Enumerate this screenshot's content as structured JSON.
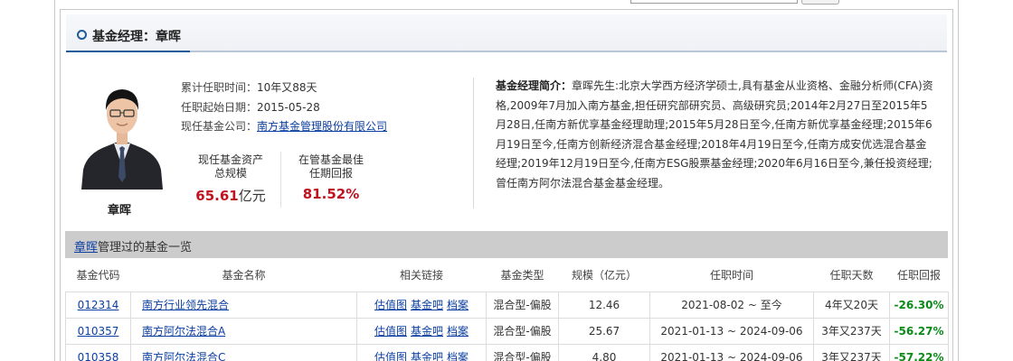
{
  "section": {
    "title": "基金经理：章晖"
  },
  "manager": {
    "name": "章晖",
    "tenure_label": "累计任职时间：",
    "tenure_value": "10年又88天",
    "start_label": "任职起始日期：",
    "start_value": "2015-05-28",
    "company_label": "现任基金公司：",
    "company_value": "南方基金管理股份有限公司"
  },
  "stats": {
    "aum_label_1": "现任基金资产",
    "aum_label_2": "总规模",
    "aum_value": "65.61",
    "aum_unit": "亿元",
    "best_label_1": "在管基金最佳",
    "best_label_2": "任期回报",
    "best_value": "81.52%"
  },
  "bio": {
    "label": "基金经理简介：",
    "text": "章晖先生:北京大学西方经济学硕士,具有基金从业资格、金融分析师(CFA)资格,2009年7月加入南方基金,担任研究部研究员、高级研究员;2014年2月27日至2015年5月28日,任南方新优享基金经理助理;2015年5月28日至今,任南方新优享基金经理;2015年6月19日至今,任南方创新经济混合基金经理;2018年4月19日至今,任南方成安优选混合基金经理;2019年12月19日至今,任南方ESG股票基金经理;2020年6月16日至今,兼任投资经理;曾任南方阿尔法混合基金基金经理。"
  },
  "funds": {
    "manager_link": "章晖",
    "title_suffix": "管理过的基金一览",
    "columns": [
      "基金代码",
      "基金名称",
      "相关链接",
      "基金类型",
      "规模（亿元）",
      "任职时间",
      "任职天数",
      "任职回报"
    ],
    "link_labels": [
      "估值图",
      "基金吧",
      "档案"
    ],
    "rows": [
      {
        "code": "012314",
        "name": "南方行业领先混合",
        "type": "混合型-偏股",
        "scale": "12.46",
        "period": "2021-08-02 ~ 至今",
        "days": "4年又20天",
        "return": "-26.30%"
      },
      {
        "code": "010357",
        "name": "南方阿尔法混合A",
        "type": "混合型-偏股",
        "scale": "25.67",
        "period": "2021-01-13 ~ 2024-09-06",
        "days": "3年又237天",
        "return": "-56.27%"
      },
      {
        "code": "010358",
        "name": "南方阿尔法混合C",
        "type": "混合型-偏股",
        "scale": "4.80",
        "period": "2021-01-13 ~ 2024-09-06",
        "days": "3年又237天",
        "return": "-57.22%"
      }
    ]
  }
}
